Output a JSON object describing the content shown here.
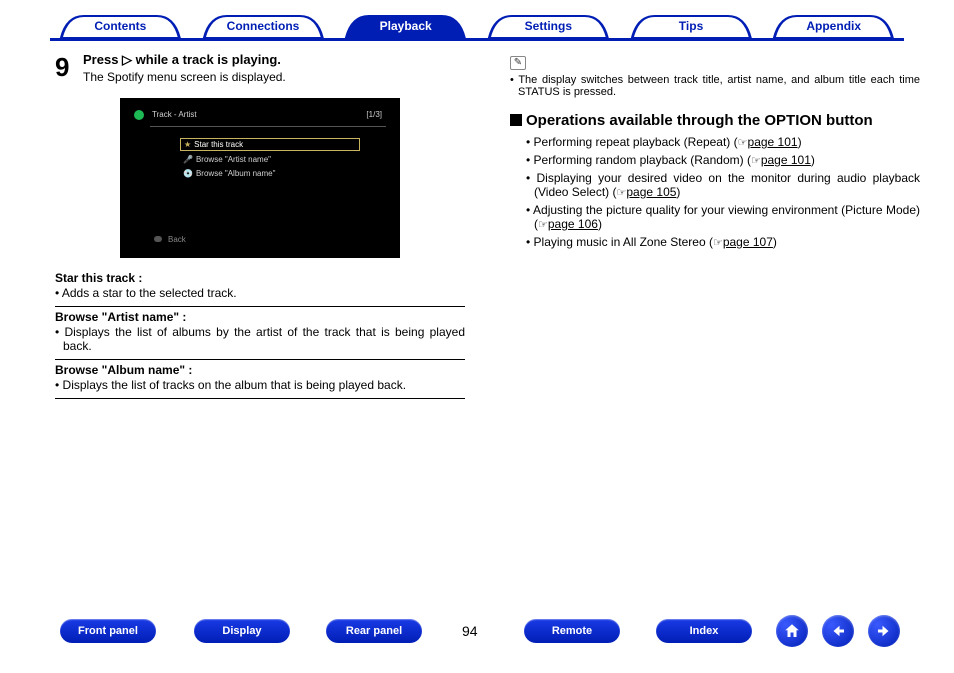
{
  "tabs": {
    "contents": "Contents",
    "connections": "Connections",
    "playback": "Playback",
    "settings": "Settings",
    "tips": "Tips",
    "appendix": "Appendix"
  },
  "step": {
    "num": "9",
    "head_pre": "Press ",
    "head_post": " while a track is playing.",
    "sub": "The Spotify menu screen is displayed."
  },
  "screenshot": {
    "title": "Track - Artist",
    "count": "[1/3]",
    "item1": "Star this track",
    "item2": "Browse \"Artist name\"",
    "item3": "Browse \"Album name\"",
    "back": "Back"
  },
  "defs": {
    "t1": "Star this track",
    "d1": "• Adds a star to the selected track.",
    "t2": "Browse \"Artist name\"",
    "d2": "• Displays the list of albums by the artist of the track that is being played back.",
    "t3": "Browse \"Album name\"",
    "d3": "• Displays the list of tracks on the album that is being played back."
  },
  "note": "• The display switches between track title, artist name, and album title each time STATUS is pressed.",
  "section_title": "Operations available through the OPTION button",
  "bullets": {
    "b1a": "• Performing repeat playback (Repeat) (",
    "b1p": "page 101",
    "b2a": "• Performing random playback (Random) (",
    "b2p": "page 101",
    "b3a": "• Displaying your desired video on the monitor during audio playback (Video Select) (",
    "b3p": "page 105",
    "b4a": "• Adjusting the picture quality for your viewing environment (Picture Mode) (",
    "b4p": "page 106",
    "b5a": "• Playing music in All Zone Stereo (",
    "b5p": "page 107",
    "close": ")"
  },
  "footer": {
    "front": "Front panel",
    "display": "Display",
    "rear": "Rear panel",
    "remote": "Remote",
    "index": "Index",
    "page": "94"
  }
}
